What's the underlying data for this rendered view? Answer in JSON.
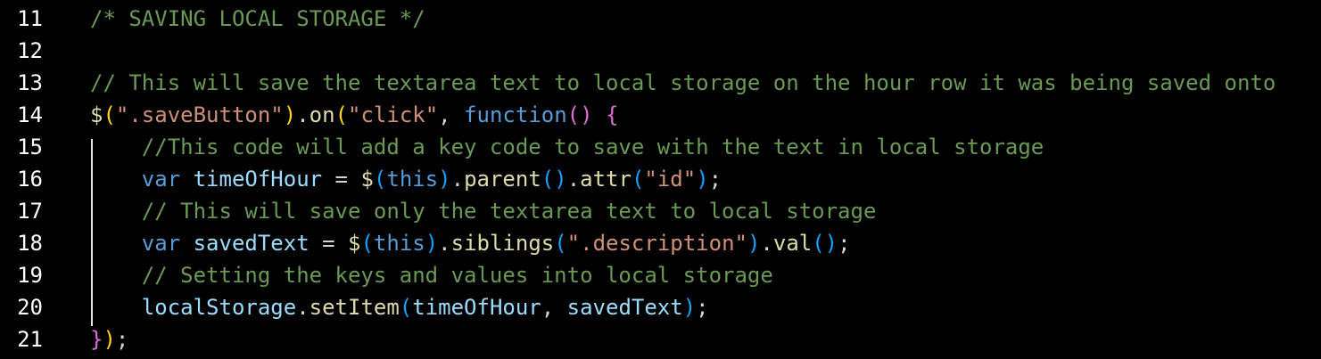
{
  "colors": {
    "background": "#000000",
    "line_number": "#ffffff",
    "comment": "#6a9955",
    "function": "#dcdcaa",
    "string": "#ce9178",
    "keyword": "#569cd6",
    "variable": "#9cdcfe",
    "punctuation": "#d4d4d4",
    "bracket_level_1": "#ffd700",
    "bracket_level_2": "#da70d6",
    "bracket_level_3": "#179fff",
    "indent_guide": "#e6e6e6"
  },
  "lines": [
    {
      "number": "11",
      "tokens": [
        {
          "t": "/* SAVING LOCAL STORAGE */",
          "c": "comment"
        }
      ]
    },
    {
      "number": "12",
      "tokens": []
    },
    {
      "number": "13",
      "tokens": [
        {
          "t": "// This will save the textarea text to local storage on the hour row it was being saved onto",
          "c": "comment"
        }
      ]
    },
    {
      "number": "14",
      "tokens": [
        {
          "t": "$",
          "c": "yellow"
        },
        {
          "t": "(",
          "c": "b1"
        },
        {
          "t": "\".saveButton\"",
          "c": "string"
        },
        {
          "t": ")",
          "c": "b1"
        },
        {
          "t": ".",
          "c": "plain"
        },
        {
          "t": "on",
          "c": "yellow"
        },
        {
          "t": "(",
          "c": "b1"
        },
        {
          "t": "\"click\"",
          "c": "string"
        },
        {
          "t": ", ",
          "c": "plain"
        },
        {
          "t": "function",
          "c": "keyword"
        },
        {
          "t": "()",
          "c": "b2"
        },
        {
          "t": " ",
          "c": "plain"
        },
        {
          "t": "{",
          "c": "b2"
        }
      ]
    },
    {
      "number": "15",
      "tokens": [
        {
          "t": "    ",
          "c": "plain"
        },
        {
          "t": "//This code will add a key code to save with the text in local storage",
          "c": "comment"
        }
      ]
    },
    {
      "number": "16",
      "tokens": [
        {
          "t": "    ",
          "c": "plain"
        },
        {
          "t": "var",
          "c": "keyword"
        },
        {
          "t": " ",
          "c": "plain"
        },
        {
          "t": "timeOfHour",
          "c": "var"
        },
        {
          "t": " = ",
          "c": "plain"
        },
        {
          "t": "$",
          "c": "yellow"
        },
        {
          "t": "(",
          "c": "b3"
        },
        {
          "t": "this",
          "c": "keyword"
        },
        {
          "t": ")",
          "c": "b3"
        },
        {
          "t": ".",
          "c": "plain"
        },
        {
          "t": "parent",
          "c": "yellow"
        },
        {
          "t": "()",
          "c": "b3"
        },
        {
          "t": ".",
          "c": "plain"
        },
        {
          "t": "attr",
          "c": "yellow"
        },
        {
          "t": "(",
          "c": "b3"
        },
        {
          "t": "\"id\"",
          "c": "string"
        },
        {
          "t": ")",
          "c": "b3"
        },
        {
          "t": ";",
          "c": "plain"
        }
      ]
    },
    {
      "number": "17",
      "tokens": [
        {
          "t": "    ",
          "c": "plain"
        },
        {
          "t": "// This will save only the textarea text to local storage",
          "c": "comment"
        }
      ]
    },
    {
      "number": "18",
      "tokens": [
        {
          "t": "    ",
          "c": "plain"
        },
        {
          "t": "var",
          "c": "keyword"
        },
        {
          "t": " ",
          "c": "plain"
        },
        {
          "t": "savedText",
          "c": "var"
        },
        {
          "t": " = ",
          "c": "plain"
        },
        {
          "t": "$",
          "c": "yellow"
        },
        {
          "t": "(",
          "c": "b3"
        },
        {
          "t": "this",
          "c": "keyword"
        },
        {
          "t": ")",
          "c": "b3"
        },
        {
          "t": ".",
          "c": "plain"
        },
        {
          "t": "siblings",
          "c": "yellow"
        },
        {
          "t": "(",
          "c": "b3"
        },
        {
          "t": "\".description\"",
          "c": "string"
        },
        {
          "t": ")",
          "c": "b3"
        },
        {
          "t": ".",
          "c": "plain"
        },
        {
          "t": "val",
          "c": "yellow"
        },
        {
          "t": "()",
          "c": "b3"
        },
        {
          "t": ";",
          "c": "plain"
        }
      ]
    },
    {
      "number": "19",
      "tokens": [
        {
          "t": "    ",
          "c": "plain"
        },
        {
          "t": "// Setting the keys and values into local storage",
          "c": "comment"
        }
      ]
    },
    {
      "number": "20",
      "tokens": [
        {
          "t": "    ",
          "c": "plain"
        },
        {
          "t": "localStorage",
          "c": "var"
        },
        {
          "t": ".",
          "c": "plain"
        },
        {
          "t": "setItem",
          "c": "yellow"
        },
        {
          "t": "(",
          "c": "b3"
        },
        {
          "t": "timeOfHour",
          "c": "var"
        },
        {
          "t": ", ",
          "c": "plain"
        },
        {
          "t": "savedText",
          "c": "var"
        },
        {
          "t": ")",
          "c": "b3"
        },
        {
          "t": ";",
          "c": "plain"
        }
      ]
    },
    {
      "number": "21",
      "tokens": [
        {
          "t": "}",
          "c": "b2"
        },
        {
          "t": ")",
          "c": "b1"
        },
        {
          "t": ";",
          "c": "plain"
        }
      ]
    }
  ]
}
